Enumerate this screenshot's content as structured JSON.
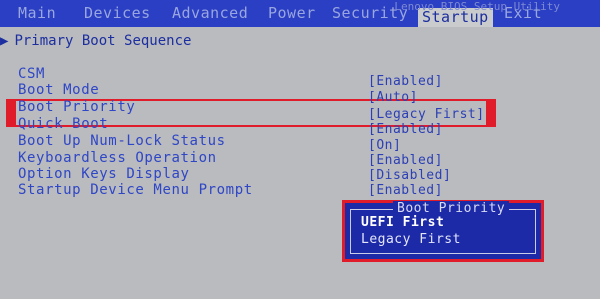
{
  "tabs": [
    "Main",
    "Devices",
    "Advanced",
    "Power",
    "Security",
    "Startup",
    "Exit"
  ],
  "active_tab": "Startup",
  "header_faint_text": "Lenovo BIOS Setup Utility",
  "section": {
    "arrow": "▶",
    "title": "Primary Boot Sequence"
  },
  "settings": [
    {
      "label": "CSM",
      "value": "[Enabled]"
    },
    {
      "label": "Boot Mode",
      "value": "[Auto]"
    },
    {
      "label": "Boot Priority",
      "value": "[Legacy First]"
    },
    {
      "label": "Quick Boot",
      "value": "[Enabled]"
    },
    {
      "label": "Boot Up Num-Lock Status",
      "value": "[On]"
    },
    {
      "label": "Keyboardless Operation",
      "value": "[Enabled]"
    },
    {
      "label": "Option Keys Display",
      "value": "[Disabled]"
    },
    {
      "label": "Startup Device Menu Prompt",
      "value": "[Enabled]"
    }
  ],
  "popup": {
    "title": "Boot Priority",
    "options": [
      "UEFI First",
      "Legacy First"
    ],
    "selected_index": 0
  },
  "colors": {
    "bios_background": "#b9bbbe",
    "header_blue": "#2a3fc4",
    "text_blue": "#2f46c6",
    "highlight_red": "#e01b2a",
    "popup_blue": "#1d2aa8"
  }
}
